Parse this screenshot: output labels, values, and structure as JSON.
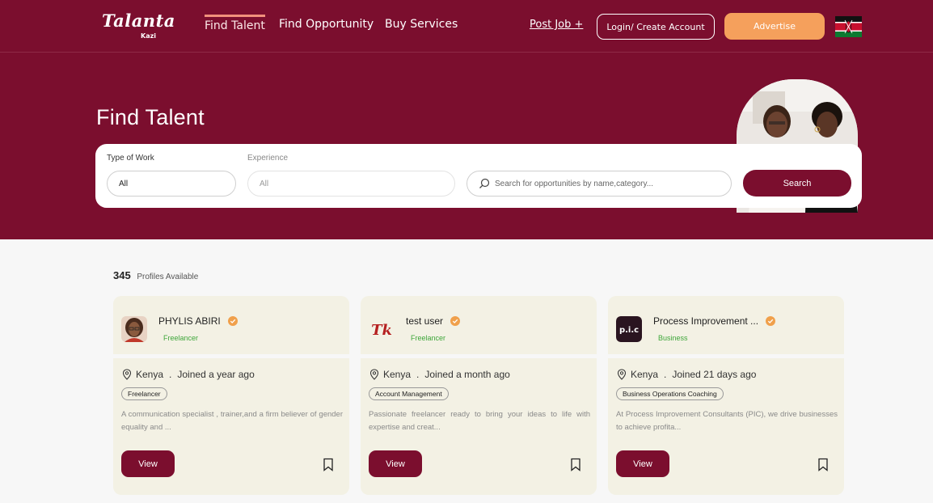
{
  "header": {
    "logo_main": "Talanta",
    "logo_sub": "Kazi",
    "nav": [
      {
        "label": "Find Talent",
        "active": true
      },
      {
        "label": "Find Opportunity",
        "active": false
      },
      {
        "label": "Buy Services",
        "active": false
      }
    ],
    "post_job": "Post Job +",
    "login": "Login/ Create Account",
    "advertise": "Advertise"
  },
  "hero": {
    "title": "Find Talent"
  },
  "search": {
    "type_label": "Type of Work",
    "type_value": "All",
    "experience_label": "Experience",
    "experience_value": "All",
    "placeholder": "Search for opportunities by name,category...",
    "button": "Search"
  },
  "results": {
    "count": "345",
    "count_label": "Profiles Available"
  },
  "cards": [
    {
      "name": "PHYLIS ABIRI",
      "role": "Freelancer",
      "location": "Kenya",
      "joined": "Joined a year ago",
      "tag": "Freelancer",
      "description": "A communication specialist , trainer,and a firm believer of gender equality and ...",
      "button": "View"
    },
    {
      "name": "test user",
      "role": "Freelancer",
      "avatar_text": "Tk",
      "location": "Kenya",
      "joined": "Joined a month ago",
      "tag": "Account Management",
      "description": "Passionate freelancer ready to bring your ideas to life with expertise and creat...",
      "button": "View"
    },
    {
      "name": "Process Improvement ...",
      "role": "Business",
      "avatar_text": "p.i.c",
      "location": "Kenya",
      "joined": "Joined 21 days ago",
      "tag": "Business Operations Coaching",
      "description": "At Process Improvement Consultants (PIC), we drive businesses to achieve profita...",
      "button": "View"
    }
  ],
  "colors": {
    "brand": "#7b0e2e",
    "accent": "#f5a05c",
    "card_bg": "#f3f1e4",
    "verified": "#f0a04b",
    "role_green": "#3ea63a"
  },
  "icons": [
    "location-pin-icon",
    "verified-badge-icon",
    "bookmark-icon",
    "search-icon",
    "kenya-flag-icon"
  ]
}
